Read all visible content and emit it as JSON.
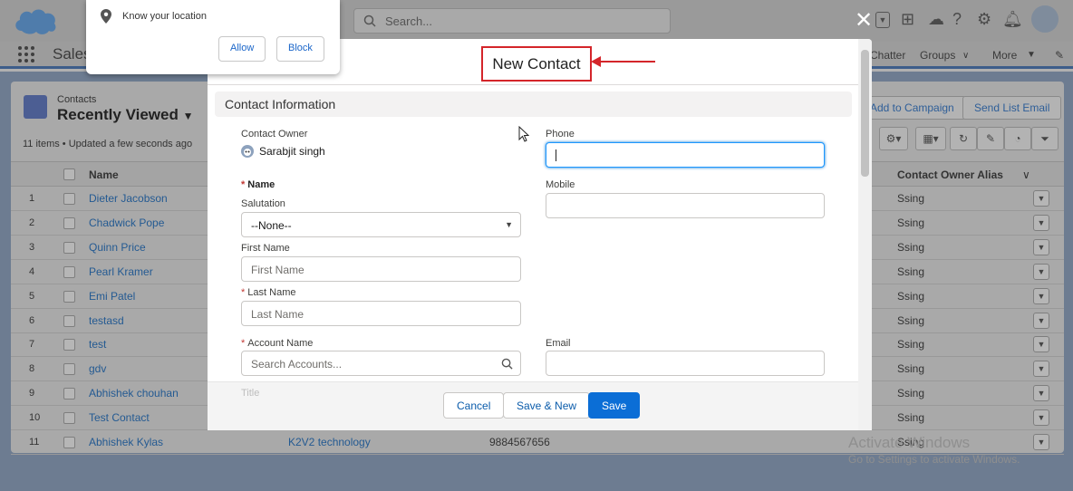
{
  "global_header": {
    "search_placeholder": "Search...",
    "icons": [
      "caret-down-icon",
      "plus-icon",
      "bell-cloud-icon",
      "help-icon",
      "gear-icon",
      "bell-icon",
      "avatar-icon"
    ]
  },
  "nav": {
    "app_name": "Sales",
    "items": [
      {
        "label": "Chatter"
      },
      {
        "label": "Groups"
      },
      {
        "label": "More"
      }
    ]
  },
  "list_view": {
    "object_label": "Contacts",
    "view_name": "Recently Viewed",
    "meta": "11 items • Updated a few seconds ago",
    "buttons": [
      "Add to Campaign",
      "Send List Email"
    ],
    "columns": [
      "Name",
      "Contact Owner Alias"
    ],
    "rows": [
      {
        "num": "1",
        "name": "Dieter Jacobson",
        "account": "",
        "phone": "",
        "alias": "Ssing"
      },
      {
        "num": "2",
        "name": "Chadwick Pope",
        "account": "",
        "phone": "",
        "alias": "Ssing"
      },
      {
        "num": "3",
        "name": "Quinn Price",
        "account": "",
        "phone": "",
        "alias": "Ssing"
      },
      {
        "num": "4",
        "name": "Pearl Kramer",
        "account": "",
        "phone": "",
        "alias": "Ssing"
      },
      {
        "num": "5",
        "name": "Emi Patel",
        "account": "",
        "phone": "",
        "alias": "Ssing"
      },
      {
        "num": "6",
        "name": "testasd",
        "account": "",
        "phone": "",
        "alias": "Ssing"
      },
      {
        "num": "7",
        "name": "test",
        "account": "",
        "phone": "",
        "alias": "Ssing"
      },
      {
        "num": "8",
        "name": "gdv",
        "account": "",
        "phone": "",
        "alias": "Ssing"
      },
      {
        "num": "9",
        "name": "Abhishek chouhan",
        "account": "",
        "phone": "",
        "alias": "Ssing"
      },
      {
        "num": "10",
        "name": "Test Contact",
        "account": "",
        "phone": "",
        "alias": "Ssing"
      },
      {
        "num": "11",
        "name": "Abhishek Kylas",
        "account": "K2V2 technology",
        "phone": "9884567656",
        "alias": "Ssing"
      }
    ]
  },
  "permission_popup": {
    "text": "Know your location",
    "allow": "Allow",
    "block": "Block"
  },
  "modal": {
    "title": "New Contact",
    "section": "Contact Information",
    "contact_owner_label": "Contact Owner",
    "contact_owner_value": "Sarabjit singh",
    "name_label": "Name",
    "salutation_label": "Salutation",
    "salutation_value": "--None--",
    "first_name_label": "First Name",
    "first_name_placeholder": "First Name",
    "last_name_label": "Last Name",
    "last_name_placeholder": "Last Name",
    "account_name_label": "Account Name",
    "account_placeholder": "Search Accounts...",
    "phone_label": "Phone",
    "mobile_label": "Mobile",
    "email_label": "Email",
    "title_label": "Title",
    "cancel": "Cancel",
    "save_new": "Save & New",
    "save": "Save"
  },
  "watermark": {
    "line1": "Activate Windows",
    "line2": "Go to Settings to activate Windows."
  },
  "colors": {
    "brand": "#0b6ed6",
    "required": "#c23934",
    "annotation": "#d4252a"
  }
}
